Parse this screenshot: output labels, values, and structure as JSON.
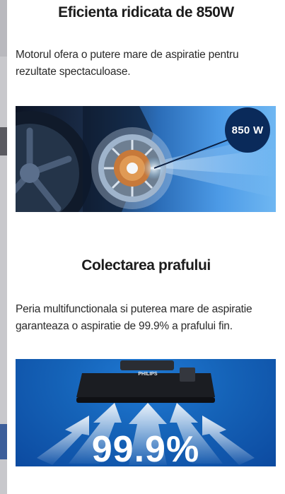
{
  "section1": {
    "title": "Eficienta ridicata de 850W",
    "text": "Motorul ofera o putere mare de aspiratie pentru rezultate spectaculoase.",
    "badge": "850 W"
  },
  "section2": {
    "title": "Colectarea prafului",
    "text": "Peria multifunctionala si puterea mare de aspiratie garanteaza o aspiratie de 99.9% a prafului fin.",
    "brand": "PHILIPS",
    "big_value": "99.9%"
  },
  "colors": {
    "badge_bg": "#0a2a5a",
    "image_blue": "#1563b8"
  }
}
